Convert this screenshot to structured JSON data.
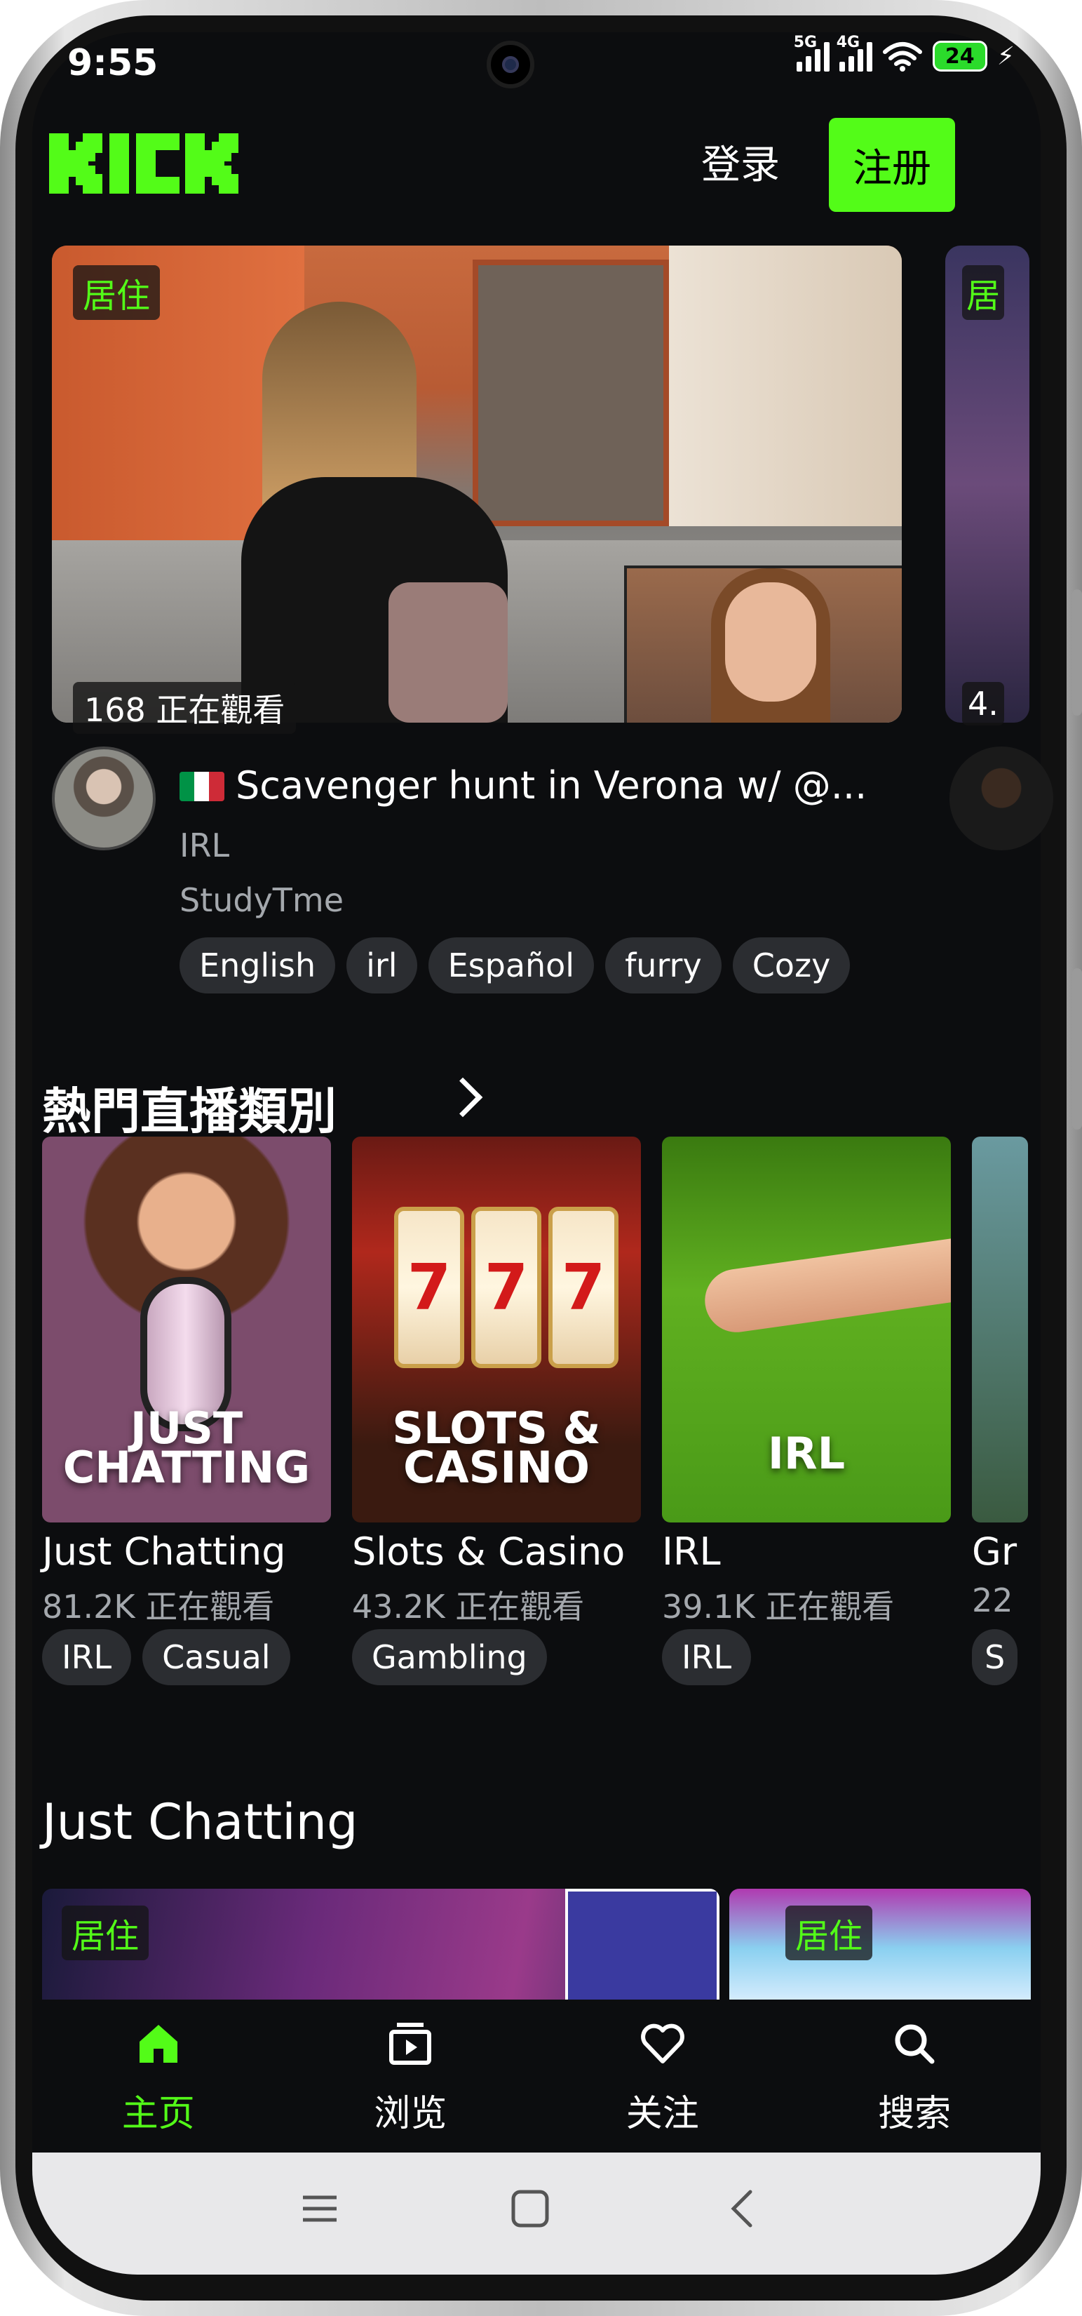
{
  "status": {
    "time": "9:55",
    "net1": "5G",
    "net2": "4G",
    "battery": "24"
  },
  "header": {
    "logo_alt": "KICK",
    "login_label": "登录",
    "register_label": "注册"
  },
  "featured": {
    "live_badge": "居住",
    "viewers": "168 正在觀看",
    "title": "Scavenger hunt in Verona w/ @...",
    "category": "IRL",
    "streamer": "StudyTme",
    "tags": [
      "English",
      "irl",
      "Español",
      "furry",
      "Cozy"
    ],
    "next_card_badge": "居",
    "next_card_viewers": "4."
  },
  "categories": {
    "title": "熱門直播類別",
    "items": [
      {
        "name": "Just Chatting",
        "art_line1": "JUST",
        "art_line2": "CHATTING",
        "viewers": "81.2K 正在觀看",
        "tags": [
          "IRL",
          "Casual"
        ]
      },
      {
        "name": "Slots & Casino",
        "art_line1": "SLOTS &",
        "art_line2": "CASINO",
        "viewers": "43.2K 正在觀看",
        "tags": [
          "Gambling"
        ]
      },
      {
        "name": "IRL",
        "art_line1": "IRL",
        "art_line2": "",
        "viewers": "39.1K 正在觀看",
        "tags": [
          "IRL"
        ]
      },
      {
        "name": "Gr",
        "viewers": "22",
        "tags": [
          "S"
        ]
      }
    ]
  },
  "just_chatting": {
    "title": "Just Chatting",
    "badge1": "居住",
    "badge2": "居住"
  },
  "nav": {
    "home": "主页",
    "browse": "浏览",
    "following": "关注",
    "search": "搜索"
  },
  "colors": {
    "accent": "#53fc18",
    "background": "#0c0d0f",
    "tag_bg": "#2b2d31",
    "muted_text": "#a4a8ad"
  }
}
